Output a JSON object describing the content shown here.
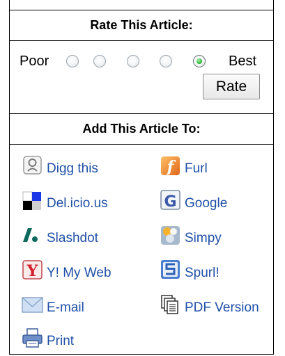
{
  "rating": {
    "header": "Rate This Article:",
    "poor_label": "Poor",
    "best_label": "Best",
    "options": [
      1,
      2,
      3,
      4,
      5
    ],
    "selected": 5,
    "button_label": "Rate"
  },
  "bookmarks": {
    "header": "Add This Article To:",
    "items": [
      {
        "label": "Digg this",
        "icon": "digg-icon"
      },
      {
        "label": "Furl",
        "icon": "furl-icon"
      },
      {
        "label": "Del.icio.us",
        "icon": "delicious-icon"
      },
      {
        "label": "Google",
        "icon": "google-icon"
      },
      {
        "label": "Slashdot",
        "icon": "slashdot-icon"
      },
      {
        "label": "Simpy",
        "icon": "simpy-icon"
      },
      {
        "label": "Y! My Web",
        "icon": "yahoo-myweb-icon"
      },
      {
        "label": "Spurl!",
        "icon": "spurl-icon"
      },
      {
        "label": "E-mail",
        "icon": "email-icon"
      },
      {
        "label": "PDF Version",
        "icon": "pdf-pages-icon"
      },
      {
        "label": "Print",
        "icon": "printer-icon"
      }
    ]
  },
  "colors": {
    "link": "#1f4fa8",
    "border": "#000000",
    "radio_selected": "#31c23a"
  }
}
